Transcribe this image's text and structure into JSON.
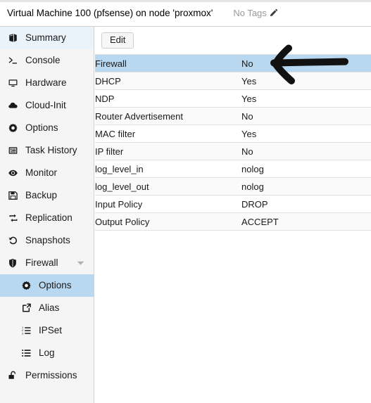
{
  "header": {
    "vm_title": "Virtual Machine 100 (pfsense) on node 'proxmox'",
    "tags_label": "No Tags",
    "edit_tags_icon": "pencil-icon"
  },
  "sidebar": {
    "items": [
      {
        "label": "Summary",
        "icon": "book-icon",
        "state": "hover",
        "level": 0
      },
      {
        "label": "Console",
        "icon": "terminal-icon",
        "state": "normal",
        "level": 0
      },
      {
        "label": "Hardware",
        "icon": "monitor-icon",
        "state": "normal",
        "level": 0
      },
      {
        "label": "Cloud-Init",
        "icon": "cloud-icon",
        "state": "normal",
        "level": 0
      },
      {
        "label": "Options",
        "icon": "gear-icon",
        "state": "normal",
        "level": 0
      },
      {
        "label": "Task History",
        "icon": "list-doc-icon",
        "state": "normal",
        "level": 0
      },
      {
        "label": "Monitor",
        "icon": "eye-icon",
        "state": "normal",
        "level": 0
      },
      {
        "label": "Backup",
        "icon": "floppy-icon",
        "state": "normal",
        "level": 0
      },
      {
        "label": "Replication",
        "icon": "replication-icon",
        "state": "normal",
        "level": 0
      },
      {
        "label": "Snapshots",
        "icon": "history-icon",
        "state": "normal",
        "level": 0
      },
      {
        "label": "Firewall",
        "icon": "shield-icon",
        "state": "expanded",
        "level": 0
      },
      {
        "label": "Options",
        "icon": "gear-icon",
        "state": "selected",
        "level": 1
      },
      {
        "label": "Alias",
        "icon": "external-link-icon",
        "state": "normal",
        "level": 1
      },
      {
        "label": "IPSet",
        "icon": "ordered-list-icon",
        "state": "normal",
        "level": 1
      },
      {
        "label": "Log",
        "icon": "unordered-list-icon",
        "state": "normal",
        "level": 1
      },
      {
        "label": "Permissions",
        "icon": "unlock-icon",
        "state": "normal",
        "level": 0
      }
    ]
  },
  "toolbar": {
    "edit_label": "Edit"
  },
  "options_table": {
    "rows": [
      {
        "key": "Firewall",
        "value": "No",
        "highlight": true
      },
      {
        "key": "DHCP",
        "value": "Yes",
        "highlight": false
      },
      {
        "key": "NDP",
        "value": "Yes",
        "highlight": false
      },
      {
        "key": "Router Advertisement",
        "value": "No",
        "highlight": false
      },
      {
        "key": "MAC filter",
        "value": "Yes",
        "highlight": false
      },
      {
        "key": "IP filter",
        "value": "No",
        "highlight": false
      },
      {
        "key": "log_level_in",
        "value": "nolog",
        "highlight": false
      },
      {
        "key": "log_level_out",
        "value": "nolog",
        "highlight": false
      },
      {
        "key": "Input Policy",
        "value": "DROP",
        "highlight": false
      },
      {
        "key": "Output Policy",
        "value": "ACCEPT",
        "highlight": false
      }
    ]
  },
  "annotation": {
    "arrow_icon": "hand-drawn-left-arrow-icon",
    "arrow_color": "#111111",
    "points_at": "Firewall"
  },
  "colors": {
    "selected_row": "#b7d8f0",
    "hover_row": "#eaf2fa",
    "sidebar_bg": "#f5f5f5",
    "row_alt": "#fafafa",
    "border": "#e0e0e0"
  }
}
